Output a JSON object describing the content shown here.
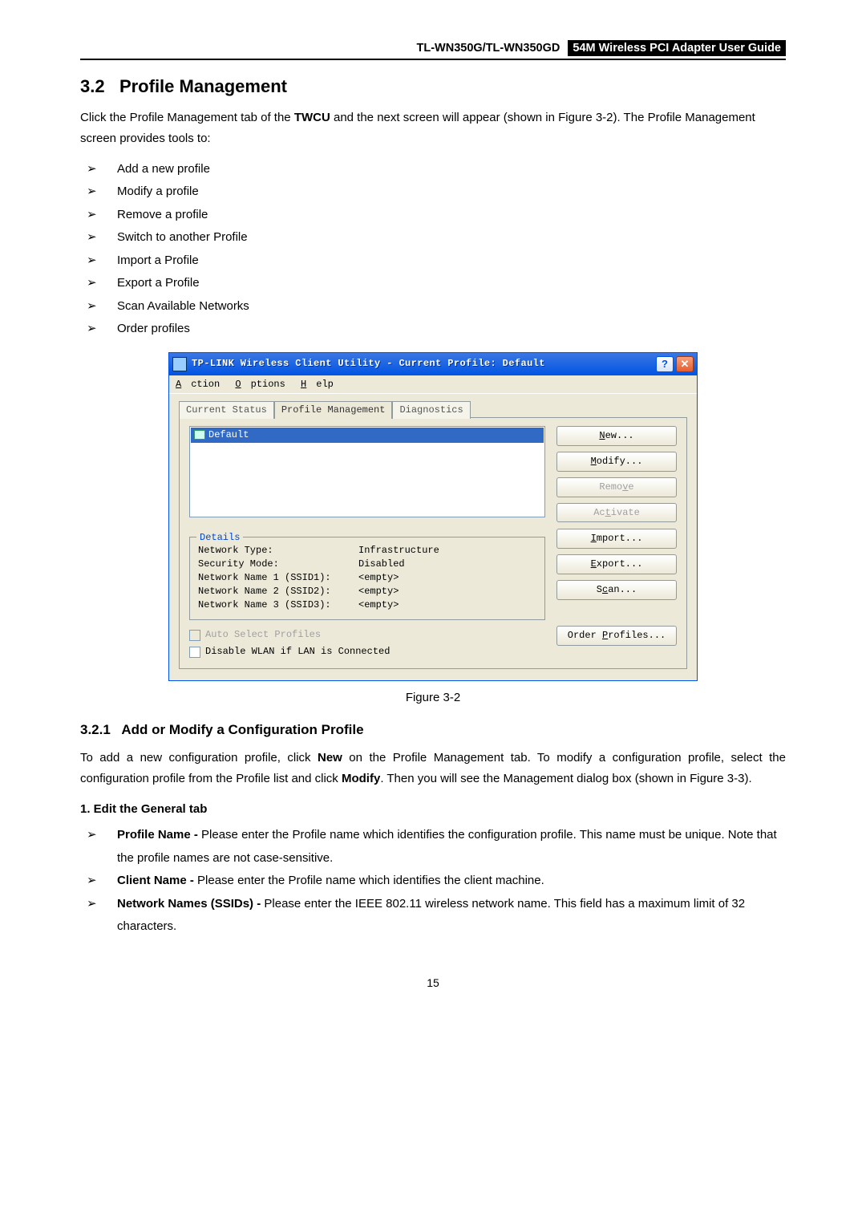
{
  "header": {
    "left": "TL-WN350G/TL-WN350GD",
    "right": "54M Wireless PCI Adapter User Guide"
  },
  "section": {
    "num": "3.2",
    "title": "Profile Management",
    "intro_a": "Click the Profile Management tab of the ",
    "intro_bold": "TWCU",
    "intro_b": " and the next screen will appear (shown in Figure 3-2). The Profile Management screen provides tools to:",
    "bullets": [
      "Add a new profile",
      "Modify a profile",
      "Remove a profile",
      "Switch to another Profile",
      "Import a Profile",
      "Export a Profile",
      "Scan Available Networks",
      "Order profiles"
    ]
  },
  "dialog": {
    "title": "TP-LINK Wireless Client Utility - Current Profile: Default",
    "menus": {
      "action": "Action",
      "options": "Options",
      "help": "Help"
    },
    "tabs": {
      "t1": "Current Status",
      "t2": "Profile Management",
      "t3": "Diagnostics"
    },
    "profile_selected": "Default",
    "buttons": {
      "new": "New...",
      "modify": "Modify...",
      "remove": "Remove",
      "activate": "Activate",
      "import": "Import...",
      "export": "Export...",
      "scan": "Scan...",
      "order": "Order Profiles..."
    },
    "details": {
      "legend": "Details",
      "rows": [
        {
          "k": "Network Type:",
          "v": "Infrastructure"
        },
        {
          "k": "Security Mode:",
          "v": "Disabled"
        },
        {
          "k": "Network Name 1 (SSID1):",
          "v": "<empty>"
        },
        {
          "k": "Network Name 2 (SSID2):",
          "v": "<empty>"
        },
        {
          "k": "Network Name 3 (SSID3):",
          "v": "<empty>"
        }
      ]
    },
    "checks": {
      "auto": "Auto Select Profiles",
      "disable": "Disable WLAN if LAN is Connected"
    }
  },
  "figure_caption": "Figure 3-2",
  "subsection": {
    "num": "3.2.1",
    "title": "Add or Modify a Configuration Profile",
    "p1a": "To add a new configuration profile, click ",
    "p1b": "New",
    "p1c": " on the Profile Management tab. To modify a configuration profile, select the configuration profile from the Profile list and click ",
    "p1d": "Modify",
    "p1e": ". Then you will see the Management dialog box (shown in Figure 3-3).",
    "ol1": "1.   Edit the General tab",
    "items": [
      {
        "b": "Profile Name - ",
        "t": "Please enter the Profile name which identifies the configuration profile. This name must be unique. Note that the profile names are not case-sensitive."
      },
      {
        "b": "Client Name - ",
        "t": "Please enter the Profile name which identifies the client machine."
      },
      {
        "b": "Network Names (SSIDs) - ",
        "t": "Please enter the IEEE 802.11 wireless network name. This field has a maximum limit of 32 characters."
      }
    ]
  },
  "page_number": "15"
}
